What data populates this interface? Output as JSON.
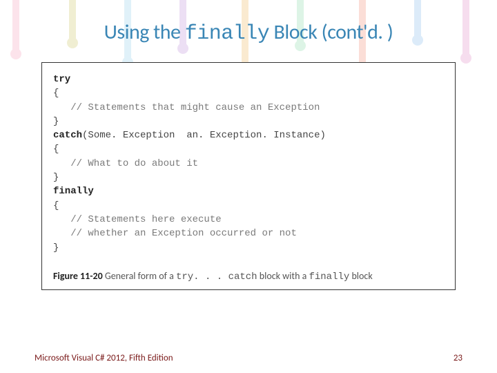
{
  "title": {
    "pre": "Using the ",
    "code": "finally",
    "post": " Block (cont'd. )"
  },
  "code": {
    "try": "try",
    "lb1": "{",
    "c1": "   // Statements that might cause an Exception",
    "rb1": "}",
    "catch_kw": "catch",
    "catch_args": "(Some. Exception  an. Exception. Instance)",
    "lb2": "{",
    "c2": "   // What to do about it",
    "rb2": "}",
    "finally": "finally",
    "lb3": "{",
    "c3a": "   // Statements here execute",
    "c3b": "   // whether an Exception occurred or not",
    "rb3": "}"
  },
  "caption": {
    "fignum": "Figure 11-20",
    "text_a": "   General form of a ",
    "code1": "try. . . catch",
    "text_b": " block with a ",
    "code2": "finally",
    "text_c": " block"
  },
  "footer": {
    "left": "Microsoft Visual C# 2012, Fifth Edition",
    "right": "23"
  }
}
